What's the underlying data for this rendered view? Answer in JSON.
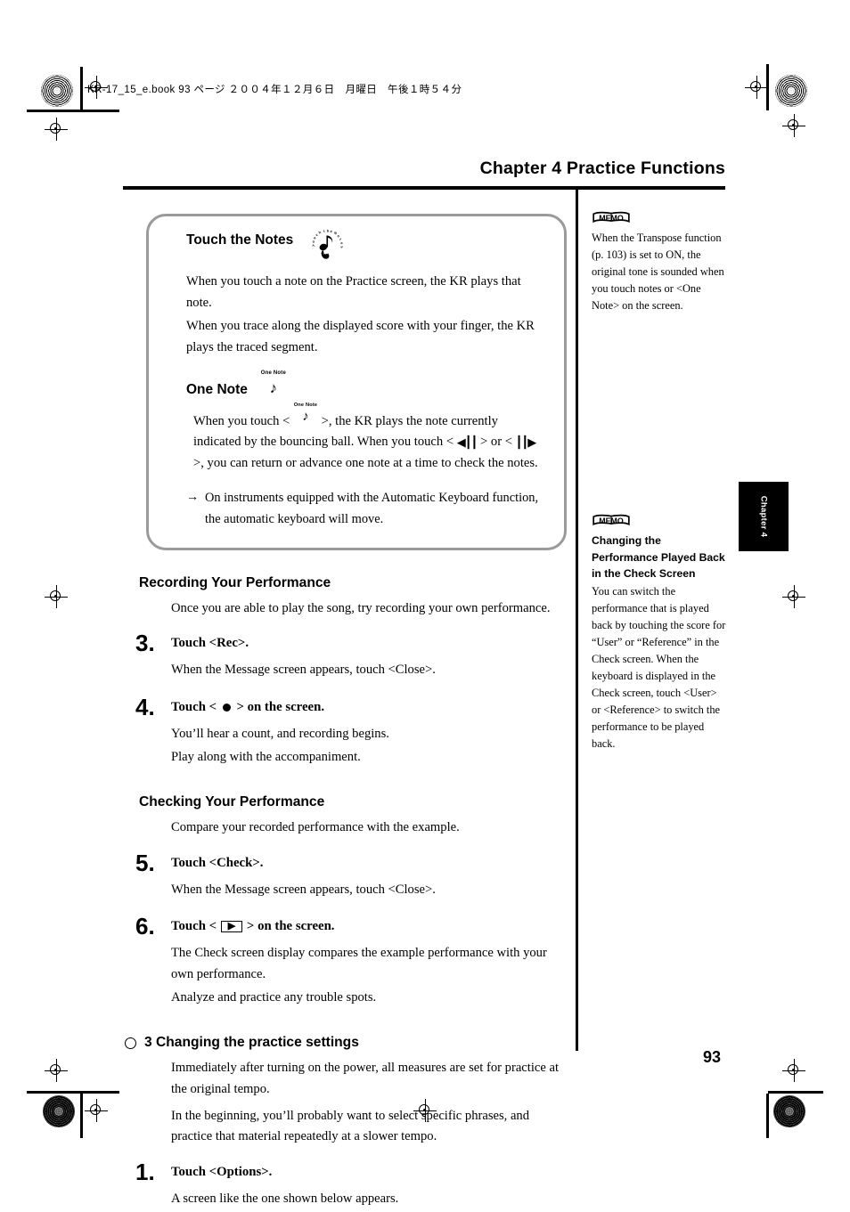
{
  "print": {
    "file_info": "KR-17_15_e.book 93 ページ ２００４年１２月６日　月曜日　午後１時５４分"
  },
  "header": {
    "chapter_title": "Chapter 4 Practice Functions"
  },
  "note_box": {
    "title": "Touch the Notes",
    "badge_icon": "touch-the-notes-badge",
    "paragraphs": [
      "When you touch a note on the Practice screen, the KR plays that note.",
      "When you trace along the displayed score with your finger, the KR plays the traced segment."
    ],
    "sub_head": "One Note",
    "button_caption": "One Note",
    "body_part_1": "When you touch < ",
    "body_part_2": " >, the KR plays the note currently indicated by the bouncing ball. When you touch < ",
    "body_part_3": " > or < ",
    "body_part_4": " >, you can return or advance one note at a time to check the notes.",
    "arrow_glyph": "→",
    "arrow_note": "On instruments equipped with the Automatic Keyboard function, the automatic keyboard will move."
  },
  "sections": {
    "recording": {
      "heading": "Recording Your Performance",
      "intro": "Once you are able to play the song, try recording your own performance.",
      "steps": [
        {
          "num": "3.",
          "title_prefix": "Touch <Rec>.",
          "lines": [
            "When the Message screen appears, touch <Close>."
          ]
        },
        {
          "num": "4.",
          "title_prefix": "Touch < ",
          "title_suffix": " > on the screen.",
          "lines": [
            "You’ll hear a count, and recording begins.",
            "Play along with the accompaniment."
          ]
        }
      ]
    },
    "checking": {
      "heading": "Checking Your Performance",
      "intro": "Compare your recorded performance with the example.",
      "steps": [
        {
          "num": "5.",
          "title_prefix": "Touch <Check>.",
          "lines": [
            "When the Message screen appears, touch <Close>."
          ]
        },
        {
          "num": "6.",
          "title_prefix": "Touch < ",
          "title_suffix": " > on the screen.",
          "lines": [
            "The Check screen display compares the example performance with your own performance.",
            "Analyze and practice any trouble spots."
          ]
        }
      ]
    },
    "practice_settings": {
      "heading": "3 Changing the practice settings",
      "intro_1": "Immediately after turning on the power, all measures are set for practice at the original tempo.",
      "intro_2": "In the beginning, you’ll probably want to select specific phrases, and practice that material repeatedly at a slower tempo.",
      "step": {
        "num": "1.",
        "title": "Touch <Options>.",
        "line": "A screen like the one shown below appears."
      }
    }
  },
  "memos": [
    {
      "icon_label": "MEMO",
      "body": "When the Transpose function (p. 103) is set to ON, the original tone is sounded when you touch notes or <One Note> on the screen."
    },
    {
      "icon_label": "MEMO",
      "bold_title": "Changing the Performance Played Back in the Check Screen",
      "body": "You can switch the performance that is played back by touching the score for “User” or “Reference” in the Check screen. When the keyboard is displayed in the Check screen, touch <User> or <Reference> to switch the performance to be played back."
    }
  ],
  "chapter_tab": {
    "label": "Chapter 4"
  },
  "page_number": "93",
  "colors": {
    "box_border": "#9a9a9a",
    "rule": "#000000",
    "tab_bg": "#000000"
  }
}
